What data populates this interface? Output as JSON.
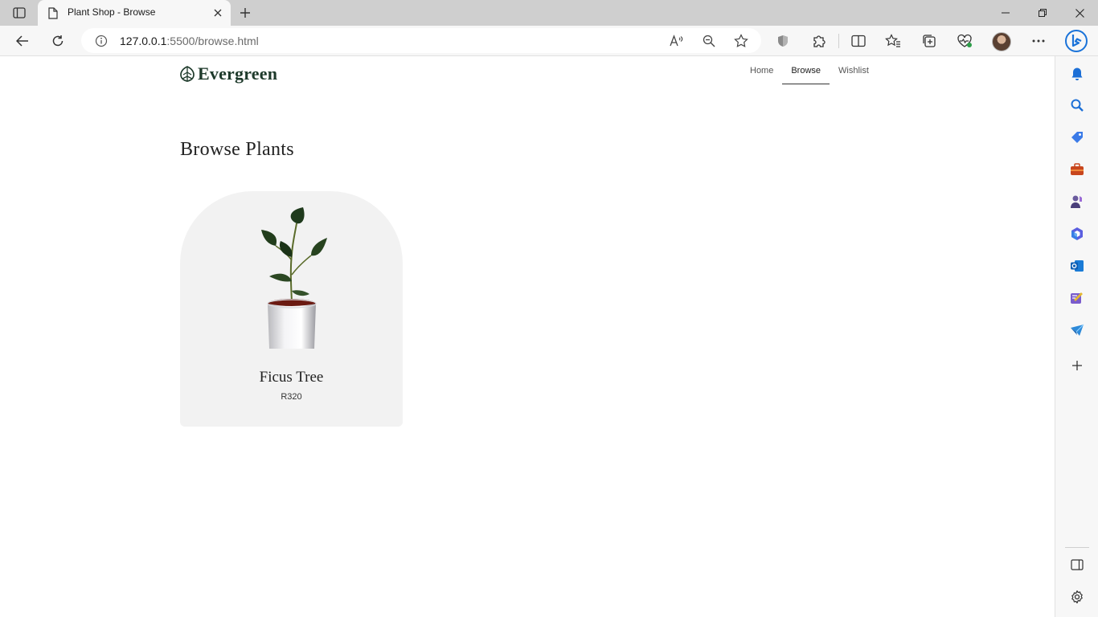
{
  "browser": {
    "tab": {
      "title": "Plant Shop - Browse"
    },
    "address": {
      "host": "127.0.0.1",
      "path": ":5500/browse.html"
    }
  },
  "site": {
    "logo": "Evergreen",
    "nav": [
      {
        "label": "Home",
        "active": false
      },
      {
        "label": "Browse",
        "active": true
      },
      {
        "label": "Wishlist",
        "active": false
      }
    ]
  },
  "page": {
    "title": "Browse Plants",
    "products": [
      {
        "name": "Ficus Tree",
        "price": "R320"
      }
    ]
  },
  "colors": {
    "brand": "#1e3a2b",
    "card_bg": "#f2f2f2",
    "chrome_bg": "#f7f7f7",
    "tabstrip_bg": "#cfcfcf"
  }
}
